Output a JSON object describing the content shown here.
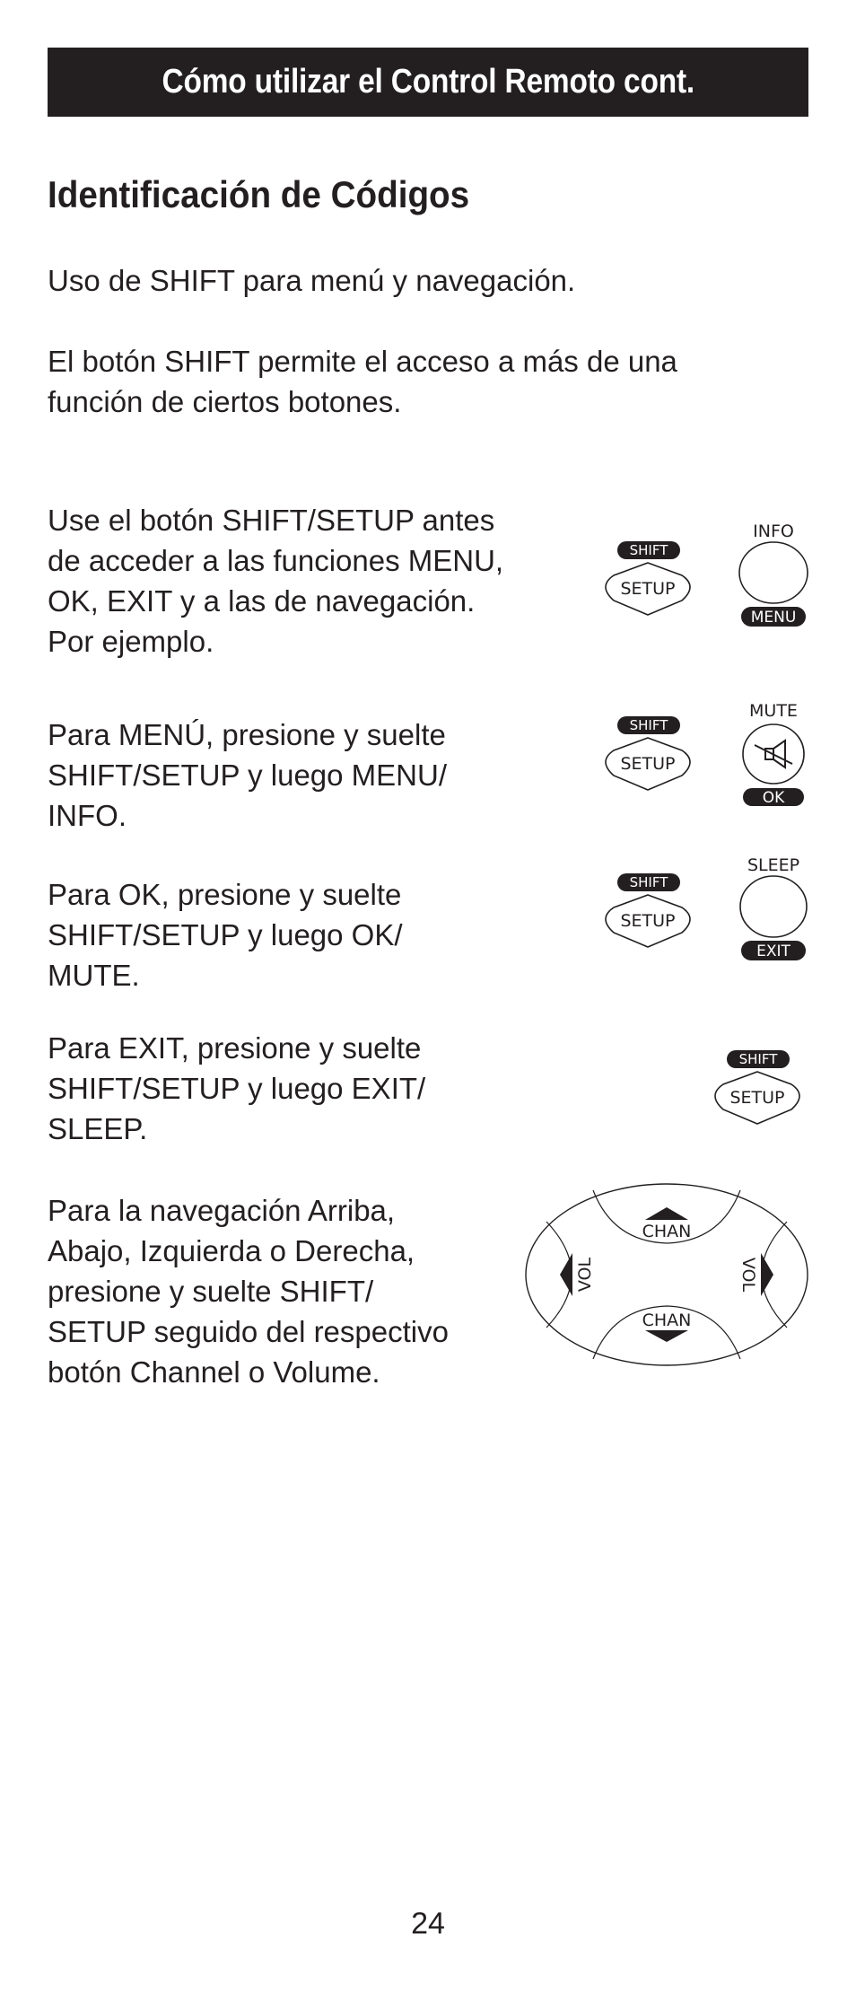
{
  "header": {
    "title": "Cómo utilizar el Control Remoto cont."
  },
  "section": {
    "heading": "Identificación de Códigos"
  },
  "intro": [
    "Uso de SHIFT para menú y navegación.",
    "El botón SHIFT permite el acceso a más de una\nfunción de ciertos botones."
  ],
  "steps": [
    {
      "text": "Use el botón SHIFT/SETUP antes\nde acceder a las funciones MENU,\nOK, EXIT y a las de navegación.\nPor ejemplo.",
      "shift_label": "SHIFT",
      "setup_label": "SETUP",
      "button_top_label": "INFO",
      "button_bottom_label": "MENU"
    },
    {
      "text": "Para MENÚ, presione y suelte\nSHIFT/SETUP y luego MENU/\nINFO.",
      "shift_label": "SHIFT",
      "setup_label": "SETUP",
      "button_top_label": "MUTE",
      "button_bottom_label": "OK",
      "button_icon": "mute-speaker-icon"
    },
    {
      "text": "Para OK, presione y suelte\nSHIFT/SETUP y luego OK/\nMUTE.",
      "shift_label": "SHIFT",
      "setup_label": "SETUP",
      "button_top_label": "SLEEP",
      "button_bottom_label": "EXIT"
    },
    {
      "text": "Para EXIT, presione y suelte\nSHIFT/SETUP y luego EXIT/\nSLEEP.",
      "shift_label": "SHIFT",
      "setup_label": "SETUP"
    },
    {
      "text": "Para la navegación Arriba,\nAbajo, Izquierda o Derecha,\npresione y suelte SHIFT/\nSETUP seguido del respectivo\nbotón Channel o Volume.",
      "dpad": {
        "up": "CHAN",
        "down": "CHAN",
        "left": "VOL",
        "right": "VOL"
      }
    }
  ],
  "footer": {
    "page_number": "24"
  }
}
